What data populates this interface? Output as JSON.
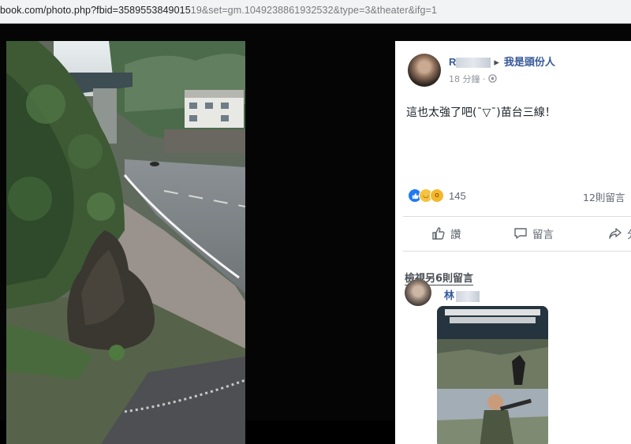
{
  "browser": {
    "url_main": "book.com/photo.php?fbid=3589553849015",
    "url_rest": "19&set=gm.1049238861932532&type=3&theater&ifg=1"
  },
  "post": {
    "author_initial": "R",
    "group_name": "我是頭份人",
    "time": "18 分鐘",
    "text": "這也太強了吧(ˉ▽ˉ)苗台三線！",
    "reaction_count": "145",
    "comment_count": "12則留言"
  },
  "actions": {
    "like_label": "讚",
    "comment_label": "留言",
    "share_label": "分"
  },
  "comments": {
    "view_more_label": "檢視另6則留言",
    "first_author_initial": "林"
  },
  "colors": {
    "link": "#365899",
    "like_blue": "#2078f4",
    "panel_bg": "#ffffff",
    "stage_bg": "#050505"
  }
}
